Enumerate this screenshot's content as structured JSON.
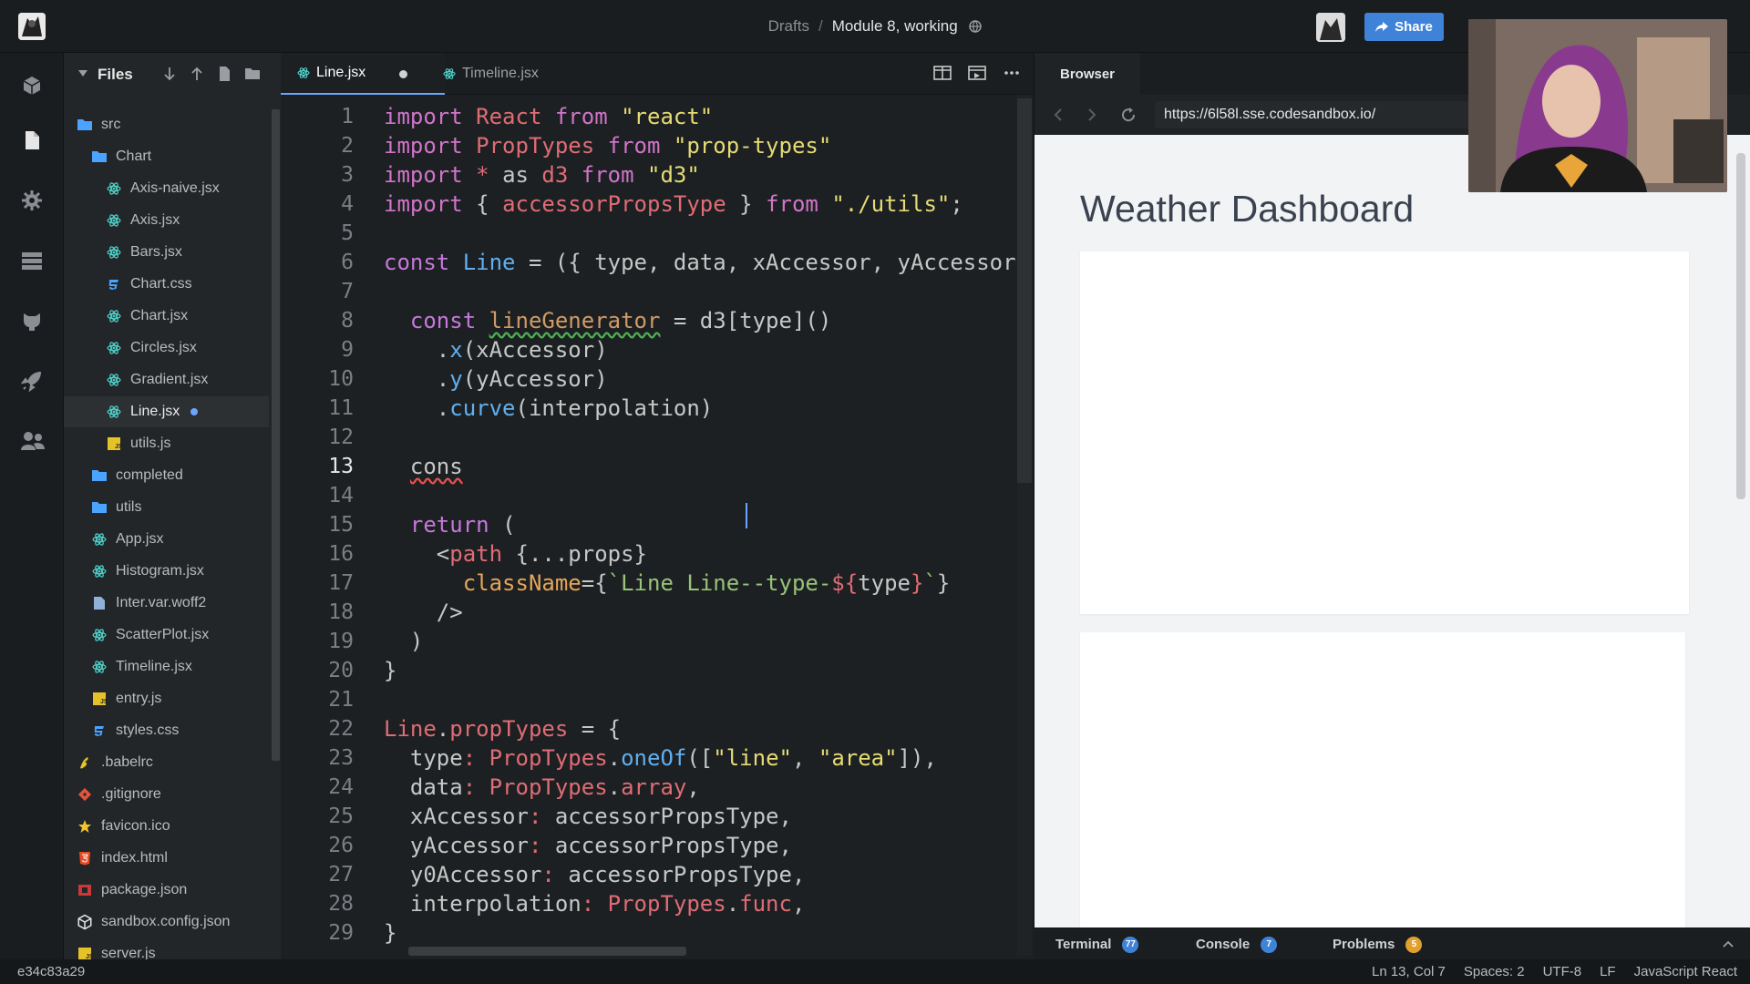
{
  "topbar": {
    "breadcrumb_root": "Drafts",
    "breadcrumb_separator": "/",
    "breadcrumb_current": "Module 8, working",
    "share_label": "Share",
    "accent": "#3f83d9"
  },
  "sidebar": {
    "title": "Files",
    "items": [
      {
        "label": "src",
        "icon": "folder-open-icon",
        "color": "#4aa3ff",
        "depth": 0
      },
      {
        "label": "Chart",
        "icon": "folder-open-icon",
        "color": "#4aa3ff",
        "depth": 1
      },
      {
        "label": "Axis-naive.jsx",
        "icon": "react-icon",
        "color": "#4fd0c7",
        "depth": 2
      },
      {
        "label": "Axis.jsx",
        "icon": "react-icon",
        "color": "#4fd0c7",
        "depth": 2
      },
      {
        "label": "Bars.jsx",
        "icon": "react-icon",
        "color": "#4fd0c7",
        "depth": 2
      },
      {
        "label": "Chart.css",
        "icon": "css-icon",
        "color": "#4aa3ff",
        "depth": 2
      },
      {
        "label": "Chart.jsx",
        "icon": "react-icon",
        "color": "#4fd0c7",
        "depth": 2
      },
      {
        "label": "Circles.jsx",
        "icon": "react-icon",
        "color": "#4fd0c7",
        "depth": 2
      },
      {
        "label": "Gradient.jsx",
        "icon": "react-icon",
        "color": "#4fd0c7",
        "depth": 2
      },
      {
        "label": "Line.jsx",
        "icon": "react-icon",
        "color": "#4fd0c7",
        "depth": 2,
        "active": true,
        "modified": true
      },
      {
        "label": "utils.js",
        "icon": "js-icon",
        "color": "#e6c229",
        "depth": 2
      },
      {
        "label": "completed",
        "icon": "folder-icon",
        "color": "#4aa3ff",
        "depth": 1
      },
      {
        "label": "utils",
        "icon": "folder-icon",
        "color": "#4aa3ff",
        "depth": 1
      },
      {
        "label": "App.jsx",
        "icon": "react-icon",
        "color": "#4fd0c7",
        "depth": 1
      },
      {
        "label": "Histogram.jsx",
        "icon": "react-icon",
        "color": "#4fd0c7",
        "depth": 1
      },
      {
        "label": "Inter.var.woff2",
        "icon": "file-icon",
        "color": "#8fb0d9",
        "depth": 1
      },
      {
        "label": "ScatterPlot.jsx",
        "icon": "react-icon",
        "color": "#4fd0c7",
        "depth": 1
      },
      {
        "label": "Timeline.jsx",
        "icon": "react-icon",
        "color": "#4fd0c7",
        "depth": 1
      },
      {
        "label": "entry.js",
        "icon": "js-icon",
        "color": "#e6c229",
        "depth": 1
      },
      {
        "label": "styles.css",
        "icon": "css-icon",
        "color": "#4aa3ff",
        "depth": 1
      },
      {
        "label": ".babelrc",
        "icon": "babel-icon",
        "color": "#e6c229",
        "depth": 0
      },
      {
        "label": ".gitignore",
        "icon": "git-icon",
        "color": "#e0533d",
        "depth": 0
      },
      {
        "label": "favicon.ico",
        "icon": "star-icon",
        "color": "#f2c230",
        "depth": 0
      },
      {
        "label": "index.html",
        "icon": "html-icon",
        "color": "#e44d26",
        "depth": 0
      },
      {
        "label": "package.json",
        "icon": "npm-icon",
        "color": "#cb3837",
        "depth": 0
      },
      {
        "label": "sandbox.config.json",
        "icon": "cube-icon",
        "color": "#e6e6e6",
        "depth": 0
      },
      {
        "label": "server.js",
        "icon": "js-icon",
        "color": "#e6c229",
        "depth": 0
      }
    ]
  },
  "editor": {
    "tabs": [
      {
        "label": "Line.jsx",
        "active": true
      },
      {
        "label": "Timeline.jsx",
        "active": false
      }
    ],
    "current_line": 13
  },
  "browser": {
    "tab_label": "Browser",
    "url": "https://6l58l.sse.codesandbox.io/",
    "page_title": "Weather Dashboard"
  },
  "devpanel": {
    "items": [
      {
        "label": "Terminal",
        "badge": "77",
        "badge_color": "#3f83d9"
      },
      {
        "label": "Console",
        "badge": "7",
        "badge_color": "#3f83d9"
      },
      {
        "label": "Problems",
        "badge": "5",
        "badge_color": "#e0a030"
      }
    ]
  },
  "statusbar": {
    "hash": "e34c83a29",
    "cursor": "Ln 13, Col 7",
    "spaces": "Spaces: 2",
    "encoding": "UTF-8",
    "eol": "LF",
    "language": "JavaScript React"
  }
}
